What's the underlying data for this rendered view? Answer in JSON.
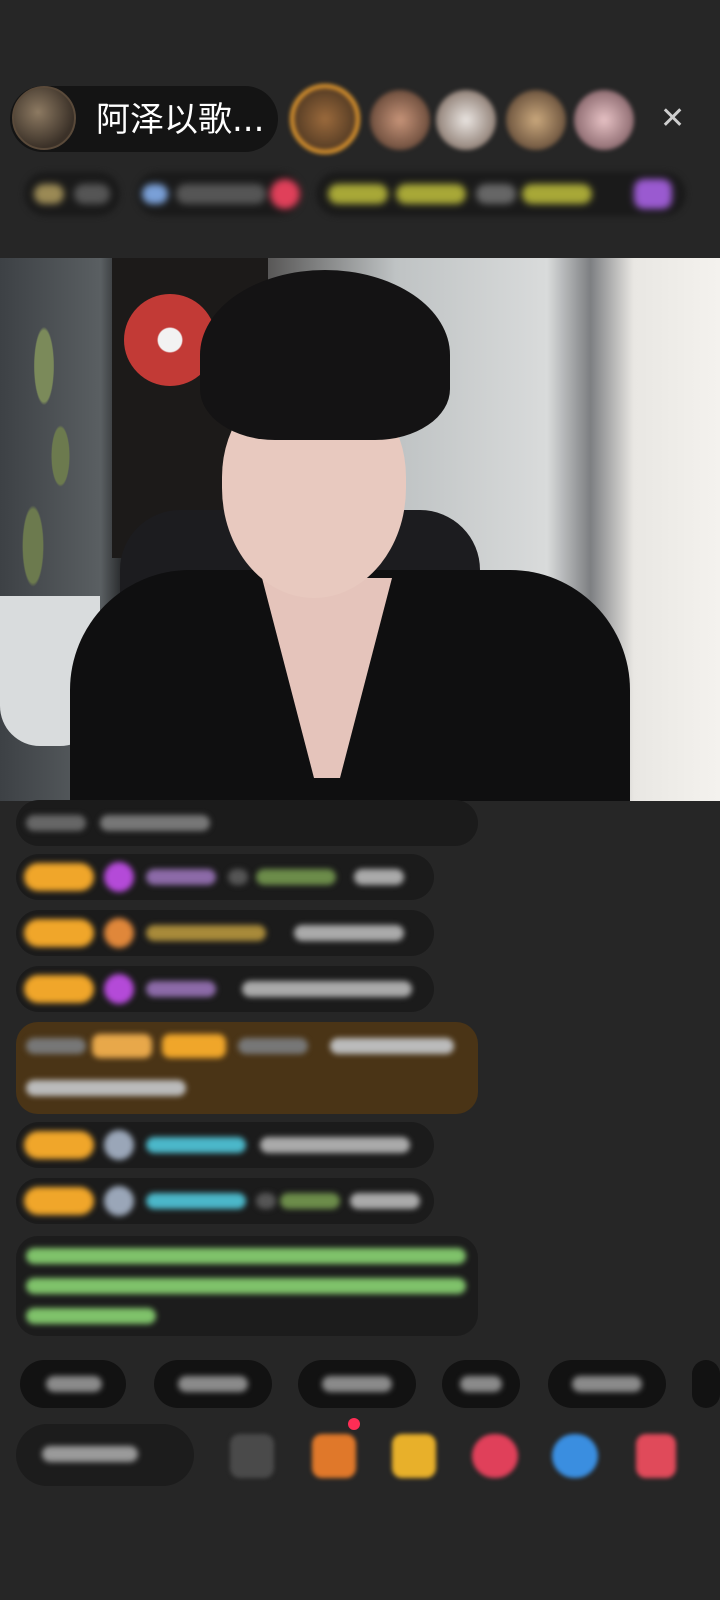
{
  "header": {
    "host_name": "阿泽以歌...",
    "close_label": "✕"
  },
  "colors": {
    "badge": "#f0a62a",
    "highlight_row": "#4a3416",
    "green_text": "#7fc26a",
    "purple_gem": "#b44ad8",
    "teal_name": "#4bb7c9"
  }
}
